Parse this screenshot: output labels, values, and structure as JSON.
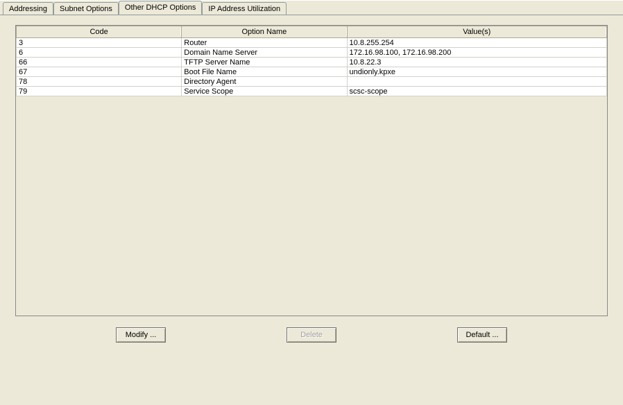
{
  "tabs": [
    {
      "label": "Addressing",
      "active": false
    },
    {
      "label": "Subnet Options",
      "active": false
    },
    {
      "label": "Other DHCP Options",
      "active": true
    },
    {
      "label": "IP Address Utilization",
      "active": false
    }
  ],
  "table": {
    "headers": {
      "code": "Code",
      "name": "Option Name",
      "value": "Value(s)"
    },
    "rows": [
      {
        "code": "3",
        "name": "Router",
        "value": "10.8.255.254"
      },
      {
        "code": "6",
        "name": "Domain Name Server",
        "value": "172.16.98.100, 172.16.98.200"
      },
      {
        "code": "66",
        "name": "TFTP Server Name",
        "value": "10.8.22.3"
      },
      {
        "code": "67",
        "name": "Boot File Name",
        "value": "undionly.kpxe"
      },
      {
        "code": "78",
        "name": "Directory Agent",
        "value": ""
      },
      {
        "code": "79",
        "name": "Service Scope",
        "value": "scsc-scope"
      }
    ]
  },
  "buttons": {
    "modify": "Modify ...",
    "delete": "Delete",
    "default": "Default ..."
  }
}
